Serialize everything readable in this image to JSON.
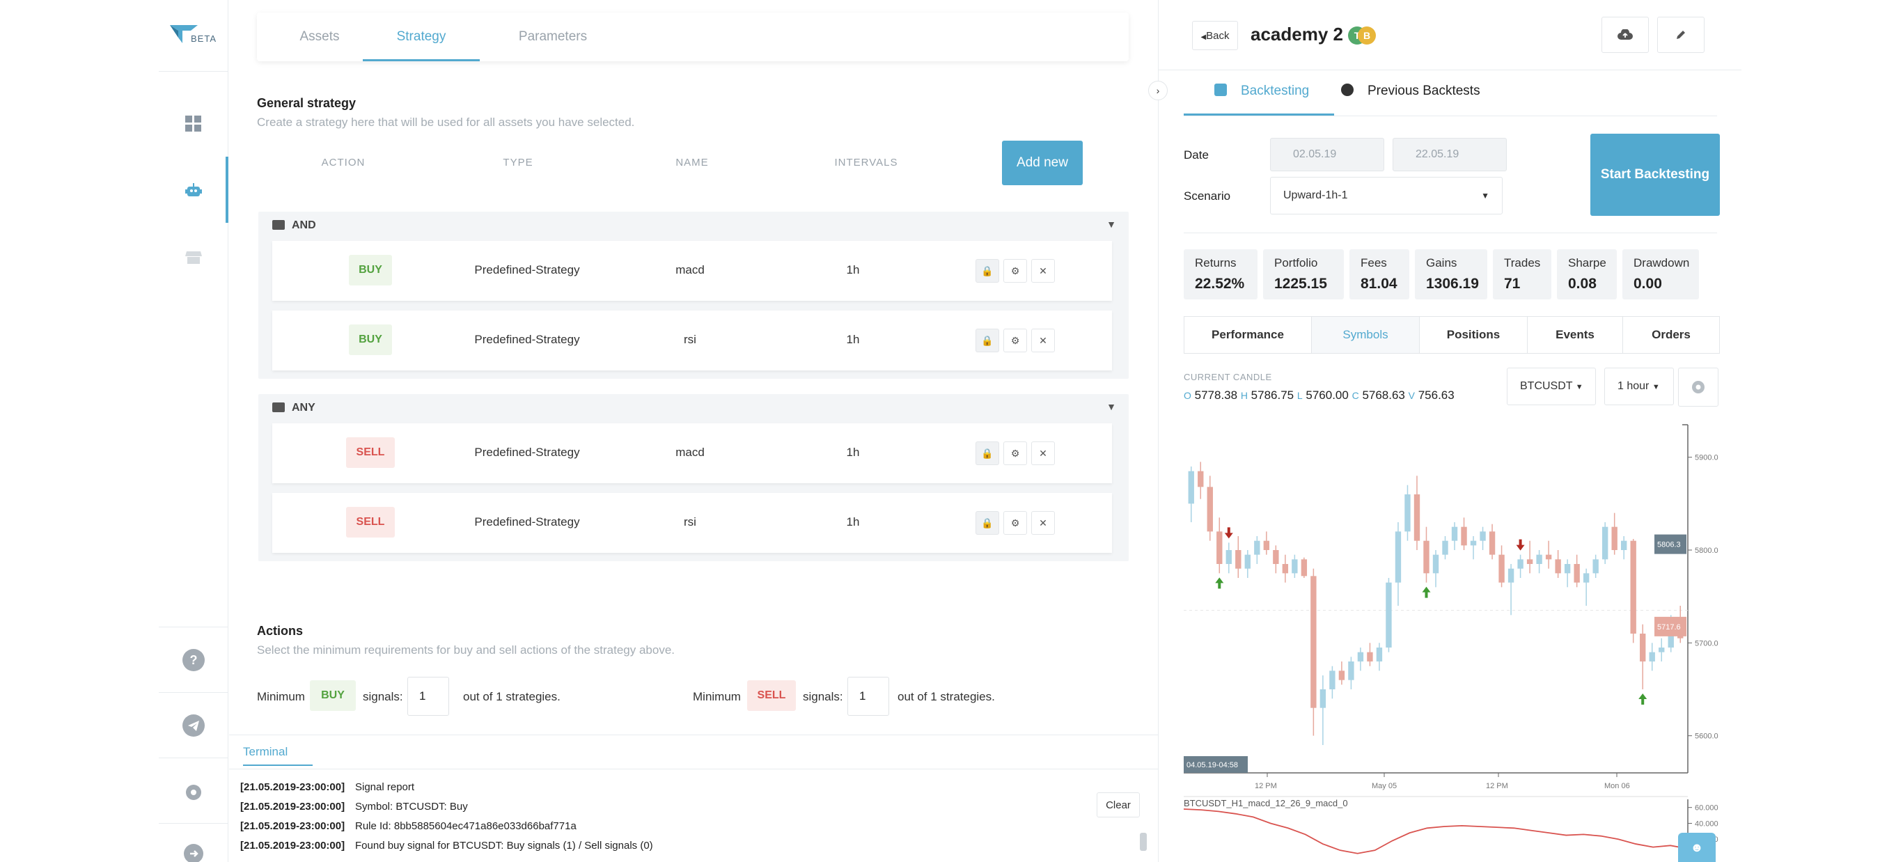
{
  "sidebar": {
    "logo_text": "BETA",
    "items": [
      {
        "name": "dashboard",
        "icon": "grid-icon"
      },
      {
        "name": "bots",
        "icon": "robot-icon",
        "active": true
      },
      {
        "name": "store",
        "icon": "store-icon"
      }
    ],
    "bottom": {
      "help": "?"
    }
  },
  "main": {
    "tabs": [
      "Assets",
      "Strategy",
      "Parameters"
    ],
    "active_tab": "Strategy",
    "general": {
      "title": "General strategy",
      "subtitle": "Create a strategy here that will be used for all assets you have selected.",
      "columns": [
        "ACTION",
        "TYPE",
        "NAME",
        "INTERVALS"
      ],
      "add_new": "Add new"
    },
    "groups": [
      {
        "name": "AND",
        "rules": [
          {
            "action": "BUY",
            "type": "Predefined-Strategy",
            "name": "macd",
            "interval": "1h"
          },
          {
            "action": "BUY",
            "type": "Predefined-Strategy",
            "name": "rsi",
            "interval": "1h"
          }
        ]
      },
      {
        "name": "ANY",
        "rules": [
          {
            "action": "SELL",
            "type": "Predefined-Strategy",
            "name": "macd",
            "interval": "1h"
          },
          {
            "action": "SELL",
            "type": "Predefined-Strategy",
            "name": "rsi",
            "interval": "1h"
          }
        ]
      }
    ],
    "actions": {
      "title": "Actions",
      "subtitle": "Select the minimum requirements for buy and sell actions of the strategy above.",
      "minimum": "Minimum",
      "signals": "signals:",
      "buy_label": "BUY",
      "sell_label": "SELL",
      "buy_value": "1",
      "sell_value": "1",
      "out_of": "out of 1 strategies."
    }
  },
  "terminal": {
    "tab": "Terminal",
    "clear": "Clear",
    "logs": [
      {
        "ts": "[21.05.2019-23:00:00]",
        "msg": "Signal report"
      },
      {
        "ts": "[21.05.2019-23:00:00]",
        "msg": "Symbol: BTCUSDT: Buy"
      },
      {
        "ts": "[21.05.2019-23:00:00]",
        "msg": "Rule Id: 8bb5885604ec471a86e033d66baf771a"
      },
      {
        "ts": "[21.05.2019-23:00:00]",
        "msg": "Found buy signal for BTCUSDT: Buy signals (1) / Sell signals (0)"
      }
    ]
  },
  "right": {
    "back": "Back",
    "title": "academy 2",
    "coins": [
      {
        "label": "T",
        "color": "#53a96b"
      },
      {
        "label": "B",
        "color": "#e8b63a"
      }
    ],
    "tabs": [
      "Backtesting",
      "Previous Backtests"
    ],
    "date_label": "Date",
    "date_from": "02.05.19",
    "date_to": "22.05.19",
    "scenario_label": "Scenario",
    "scenario_value": "Upward-1h-1",
    "start_button": "Start Backtesting",
    "stats": [
      {
        "label": "Returns",
        "value": "22.52%"
      },
      {
        "label": "Portfolio",
        "value": "1225.15"
      },
      {
        "label": "Fees",
        "value": "81.04"
      },
      {
        "label": "Gains",
        "value": "1306.19"
      },
      {
        "label": "Trades",
        "value": "71"
      },
      {
        "label": "Sharpe",
        "value": "0.08"
      },
      {
        "label": "Drawdown",
        "value": "0.00"
      }
    ],
    "perf_tabs": [
      "Performance",
      "Symbols",
      "Positions",
      "Events",
      "Orders"
    ],
    "active_perf_tab": "Symbols",
    "current_candle": "CURRENT CANDLE",
    "ohlc": {
      "o_label": "O",
      "o": "5778.38",
      "h_label": "H",
      "h": "5786.75",
      "l_label": "L",
      "l": "5760.00",
      "c_label": "C",
      "c": "5768.63",
      "v_label": "V",
      "v": "756.63"
    },
    "symbol_select": "BTCUSDT",
    "interval_select": "1 hour"
  },
  "chart_data": {
    "type": "candlestick",
    "y_ticks": [
      "5900.0",
      "5800.0",
      "5700.0",
      "5600.0"
    ],
    "ylim": [
      5560,
      5935
    ],
    "x_ticks": [
      "12 PM",
      "May 05",
      "12 PM",
      "Mon 06"
    ],
    "price_tags": [
      "5806.3",
      "5717.6"
    ],
    "cursor_label": "04.05.19-04:58",
    "colors": {
      "up": "#a9d3e4",
      "down": "#e6a89d",
      "buy_arrow": "#3f9a32",
      "sell_arrow": "#b22a22"
    },
    "candles": [
      [
        5850,
        5890,
        5830,
        5885
      ],
      [
        5885,
        5895,
        5855,
        5868
      ],
      [
        5868,
        5880,
        5810,
        5820
      ],
      [
        5820,
        5835,
        5775,
        5785
      ],
      [
        5785,
        5808,
        5775,
        5800
      ],
      [
        5800,
        5815,
        5770,
        5780
      ],
      [
        5780,
        5800,
        5770,
        5795
      ],
      [
        5795,
        5815,
        5785,
        5810
      ],
      [
        5810,
        5820,
        5795,
        5800
      ],
      [
        5800,
        5805,
        5775,
        5785
      ],
      [
        5785,
        5795,
        5765,
        5775
      ],
      [
        5775,
        5795,
        5770,
        5790
      ],
      [
        5790,
        5792,
        5770,
        5772
      ],
      [
        5772,
        5780,
        5600,
        5630
      ],
      [
        5630,
        5665,
        5590,
        5650
      ],
      [
        5650,
        5675,
        5640,
        5670
      ],
      [
        5670,
        5680,
        5655,
        5660
      ],
      [
        5660,
        5685,
        5650,
        5680
      ],
      [
        5680,
        5695,
        5670,
        5690
      ],
      [
        5690,
        5700,
        5675,
        5680
      ],
      [
        5680,
        5700,
        5670,
        5695
      ],
      [
        5695,
        5770,
        5690,
        5765
      ],
      [
        5765,
        5830,
        5740,
        5820
      ],
      [
        5820,
        5870,
        5810,
        5860
      ],
      [
        5860,
        5880,
        5800,
        5810
      ],
      [
        5810,
        5825,
        5765,
        5775
      ],
      [
        5775,
        5800,
        5760,
        5795
      ],
      [
        5795,
        5815,
        5790,
        5810
      ],
      [
        5810,
        5830,
        5800,
        5825
      ],
      [
        5825,
        5835,
        5800,
        5805
      ],
      [
        5805,
        5815,
        5790,
        5810
      ],
      [
        5810,
        5825,
        5800,
        5820
      ],
      [
        5820,
        5828,
        5790,
        5795
      ],
      [
        5795,
        5805,
        5760,
        5765
      ],
      [
        5765,
        5785,
        5730,
        5780
      ],
      [
        5780,
        5795,
        5770,
        5790
      ],
      [
        5790,
        5810,
        5775,
        5785
      ],
      [
        5785,
        5800,
        5775,
        5795
      ],
      [
        5795,
        5810,
        5780,
        5790
      ],
      [
        5790,
        5800,
        5770,
        5775
      ],
      [
        5775,
        5790,
        5760,
        5785
      ],
      [
        5785,
        5795,
        5760,
        5765
      ],
      [
        5765,
        5780,
        5740,
        5775
      ],
      [
        5775,
        5795,
        5770,
        5790
      ],
      [
        5790,
        5830,
        5785,
        5825
      ],
      [
        5825,
        5840,
        5795,
        5800
      ],
      [
        5800,
        5815,
        5790,
        5810
      ],
      [
        5810,
        5812,
        5700,
        5710
      ],
      [
        5710,
        5720,
        5650,
        5680
      ],
      [
        5680,
        5700,
        5670,
        5690
      ],
      [
        5690,
        5705,
        5680,
        5695
      ],
      [
        5695,
        5730,
        5690,
        5725
      ],
      [
        5725,
        5740,
        5700,
        5705
      ]
    ],
    "buy_markers": [
      3,
      25,
      48
    ],
    "sell_markers": [
      4,
      35,
      50
    ],
    "indicator": {
      "label": "BTCUSDT_H1_macd_12_26_9_macd_0",
      "y_ticks": [
        "60.000",
        "40.000",
        "20.000"
      ],
      "values": [
        58,
        57,
        55,
        52,
        48,
        40,
        34,
        26,
        14,
        6,
        2,
        6,
        18,
        28,
        34,
        36,
        37,
        36,
        35,
        34,
        31,
        28,
        25,
        26,
        24,
        20,
        14,
        10,
        12,
        8
      ]
    }
  }
}
